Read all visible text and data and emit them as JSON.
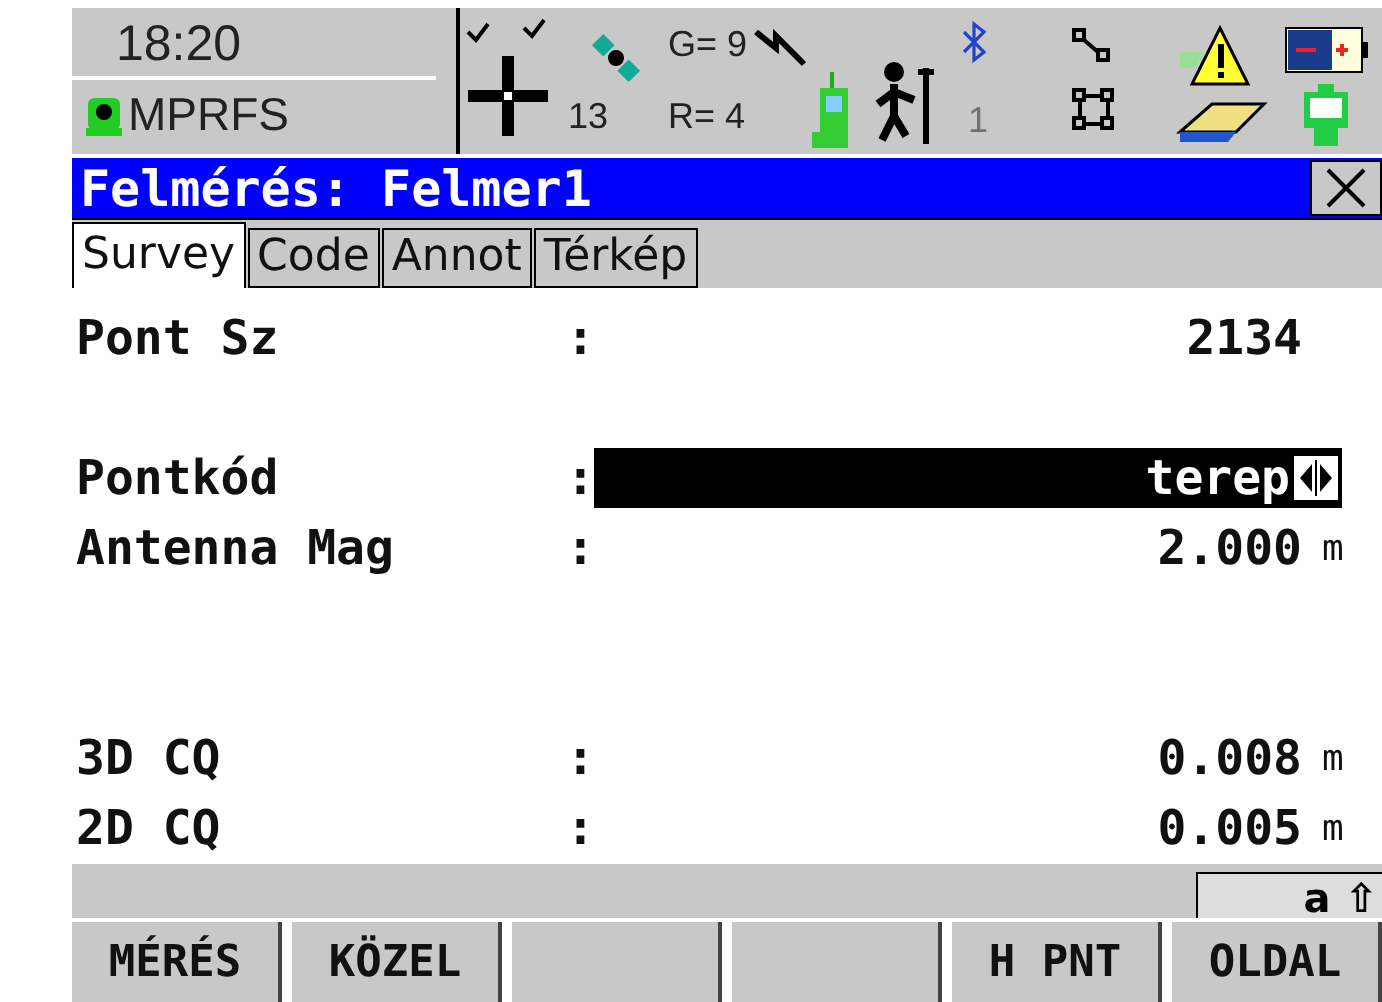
{
  "status": {
    "time": "18:20",
    "mode": "MPRFS",
    "satellites": "13",
    "gps": "G= 9",
    "glonass": "R= 4",
    "port": "1"
  },
  "window": {
    "title": "Felmérés: Felmer1"
  },
  "tabs": [
    {
      "label": "Survey",
      "selected": true
    },
    {
      "label": "Code",
      "selected": false
    },
    {
      "label": "Annot",
      "selected": false
    },
    {
      "label": "Térkép",
      "selected": false
    }
  ],
  "fields": [
    {
      "kind": "text",
      "label": "Pont Sz",
      "separator": ":",
      "value": "2134"
    },
    {
      "kind": "spacer"
    },
    {
      "kind": "list",
      "label": "Pontkód",
      "separator": ":",
      "value": "terep"
    },
    {
      "kind": "text",
      "label": "Antenna Mag",
      "separator": ":",
      "value": "2.000",
      "unit": "m"
    },
    {
      "kind": "spacer"
    },
    {
      "kind": "spacer"
    },
    {
      "kind": "text",
      "label": "3D CQ",
      "separator": ":",
      "value": "0.008",
      "unit": "m"
    },
    {
      "kind": "text",
      "label": "2D CQ",
      "separator": ":",
      "value": "0.005",
      "unit": "m"
    }
  ],
  "input_mode": "a ⇧",
  "softkeys": [
    {
      "kind": "key",
      "label": "MÉRÉS"
    },
    {
      "kind": "key",
      "label": "KÖZEL"
    },
    {
      "kind": "empty"
    },
    {
      "kind": "empty"
    },
    {
      "kind": "key",
      "label": "H PNT"
    },
    {
      "kind": "key",
      "label": "OLDAL"
    }
  ]
}
